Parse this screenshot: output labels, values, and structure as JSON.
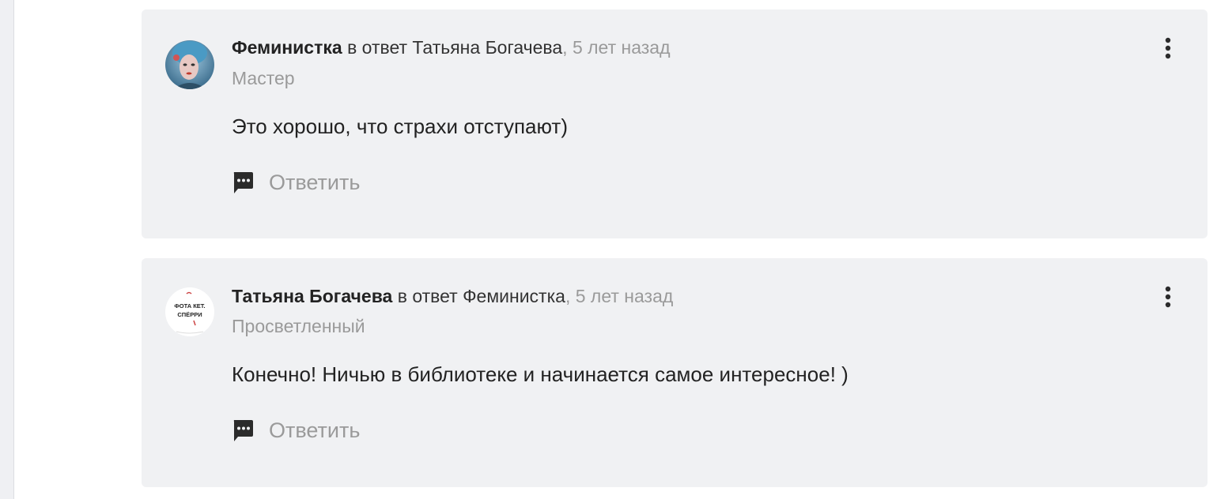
{
  "comments": [
    {
      "author": "Феминистка",
      "reply_prefix": "в ответ",
      "reply_to": "Татьяна Богачева",
      "separator": ",",
      "time": "5 лет назад",
      "rank": "Мастер",
      "text": "Это хорошо, что страхи отступают)",
      "reply_label": "Ответить",
      "avatar_icon": "user-avatar-portrait"
    },
    {
      "author": "Татьяна Богачева",
      "reply_prefix": "в ответ",
      "reply_to": "Феминистка",
      "separator": ",",
      "time": "5 лет назад",
      "rank": "Просветленный",
      "text": "Конечно! Ничью в библиотеке и начинается самое интересное! )",
      "reply_label": "Ответить",
      "avatar_icon": "user-avatar-logo",
      "avatar_logo_lines": [
        "ФОТА КЕТ.",
        "СПЁРРИ"
      ]
    }
  ],
  "icons": {
    "reply": "chat-bubble-icon",
    "more": "more-vertical-icon"
  },
  "colors": {
    "card_background": "#f0f1f3",
    "muted_text": "#9a9a9a",
    "main_text": "#222222"
  }
}
